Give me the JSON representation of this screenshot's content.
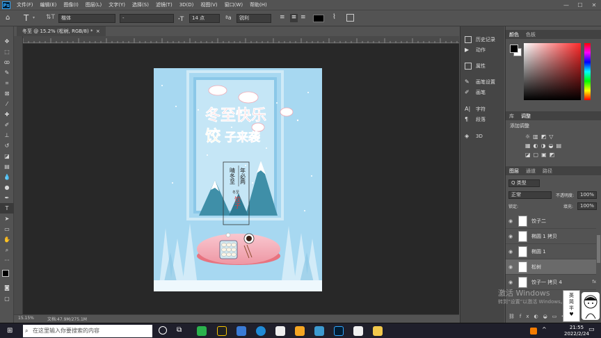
{
  "app": {
    "logo": "Ps"
  },
  "menu": [
    "文件(F)",
    "编辑(E)",
    "图像(I)",
    "图层(L)",
    "文字(Y)",
    "选择(S)",
    "滤镜(T)",
    "3D(D)",
    "视图(V)",
    "窗口(W)",
    "帮助(H)"
  ],
  "window_controls": {
    "min": "—",
    "max": "☐",
    "close": "✕"
  },
  "options": {
    "tool_icon": "type-tool-icon",
    "font_family": "楷体",
    "font_style": "-",
    "font_size": "14 点",
    "anti_alias": "锐利",
    "text_color": "#000000"
  },
  "document": {
    "tab_title": "冬至 @ 15.2% (松树, RGB/8) *",
    "close": "×",
    "zoom": "15.15%",
    "doc_info": "文档:47.9M/275.1M"
  },
  "poster": {
    "title_line1": "冬至快乐",
    "title_line2_a": "饺",
    "title_line2_b": "子来袭",
    "poem_right": "年必两",
    "poem_left": "晴冬至",
    "poem_bottom": "冬至",
    "red_chars": "饺子",
    "colors": {
      "bg": "#a7d8f1",
      "frame": "#8bc8e8",
      "title": "#f07a8a",
      "table": "#f5b5bf",
      "mountain": "#3f8fa8"
    }
  },
  "dock": {
    "history": "历史记录",
    "actions": "动作",
    "properties": "属性",
    "brush_settings": "画笔设置",
    "brush": "画笔",
    "character": "字符",
    "paragraph": "段落",
    "threed": "3D"
  },
  "right_panel": {
    "color_tabs": [
      "颜色",
      "色板"
    ],
    "adjust_tabs": [
      "库",
      "调整"
    ],
    "add_adjust": "添加调整",
    "layer_tabs": [
      "图层",
      "通道",
      "路径"
    ],
    "kind": "Q 类型",
    "blend": "正常",
    "opacity_label": "不透明度:",
    "opacity": "100%",
    "lock_label": "锁定:",
    "fill_label": "填充:",
    "fill": "100%",
    "layers": [
      {
        "name": "饺子二",
        "selected": false
      },
      {
        "name": "椭圆 1 拷贝",
        "selected": false
      },
      {
        "name": "椭圆 1",
        "selected": false
      },
      {
        "name": "松树",
        "selected": true
      },
      {
        "name": "饺子一 拷贝 4",
        "selected": false
      }
    ]
  },
  "watermark": {
    "line1": "激活 Windows",
    "line2": "转到“设置”以激活 Windows。"
  },
  "sticker": {
    "line1": "英",
    "line2": "简",
    "line3": "半",
    "heart": "♥"
  },
  "taskbar": {
    "search_placeholder": "在这里输入你要搜索的内容",
    "time": "21:55",
    "date": "2022/2/24",
    "ime": "英"
  }
}
